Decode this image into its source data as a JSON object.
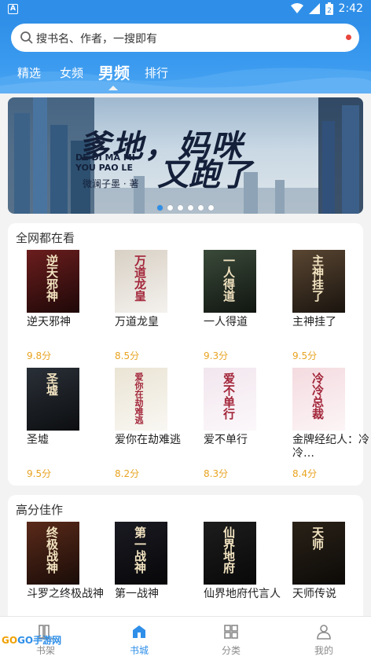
{
  "statusbar": {
    "app_icon": "A",
    "time": "2:42",
    "battery": "2"
  },
  "search": {
    "placeholder": "搜书名、作者，一搜即有"
  },
  "tabs": [
    {
      "label": "精选"
    },
    {
      "label": "女频"
    },
    {
      "label": "男频"
    },
    {
      "label": "排行"
    }
  ],
  "banner": {
    "title_line1": "爹地，妈咪",
    "title_line2": "又跑了",
    "pinyin_line1": "DE DI MA MI",
    "pinyin_line2": "YOU PAO LE",
    "author": "微澜子墨 · 著",
    "dot_count": 6,
    "active_dot": 0
  },
  "section1": {
    "title": "全网都在看",
    "books": [
      {
        "name": "逆天邪神",
        "score": "9.8分",
        "cover_text": "逆天邪神",
        "cover_bg": "#6b1d1d"
      },
      {
        "name": "万道龙皇",
        "score": "8.5分",
        "cover_text": "万道龙皇",
        "cover_bg": "#d8d0c4"
      },
      {
        "name": "一人得道",
        "score": "9.3分",
        "cover_text": "一人得道",
        "cover_bg": "#3a4a3a"
      },
      {
        "name": "主神挂了",
        "score": "9.5分",
        "cover_text": "主神挂了",
        "cover_bg": "#5a4632"
      },
      {
        "name": "圣墟",
        "score": "9.5分",
        "cover_text": "圣墟",
        "cover_bg": "#2a3038"
      },
      {
        "name": "爱你在劫难逃",
        "score": "8.2分",
        "cover_text": "爱你在劫难逃",
        "cover_bg": "#eae4d4"
      },
      {
        "name": "爱不单行",
        "score": "8.3分",
        "cover_text": "爱不单行",
        "cover_bg": "#f2e6ee"
      },
      {
        "name": "金牌经纪人：冷冷…",
        "score": "8.4分",
        "cover_text": "冷冷总裁",
        "cover_bg": "#f4dbe0"
      }
    ]
  },
  "section2": {
    "title": "高分佳作",
    "books": [
      {
        "name": "斗罗之终极战神",
        "cover_text": "终极战神",
        "cover_bg": "#5a2a1a"
      },
      {
        "name": "第一战神",
        "cover_text": "第一战神",
        "cover_bg": "#1a1a22"
      },
      {
        "name": "仙界地府代言人",
        "cover_text": "仙界地府",
        "cover_bg": "#1d1d1d"
      },
      {
        "name": "天师传说",
        "cover_text": "天师",
        "cover_bg": "#2a2218"
      }
    ]
  },
  "bottom_nav": [
    {
      "label": "书架",
      "icon": "bookshelf-icon"
    },
    {
      "label": "书城",
      "icon": "bookstore-icon",
      "active": true
    },
    {
      "label": "分类",
      "icon": "category-icon"
    },
    {
      "label": "我的",
      "icon": "profile-icon"
    }
  ],
  "watermark": {
    "text1": "GO",
    "text2": "GO",
    "text3": "手游网"
  },
  "colors": {
    "accent": "#2f8fe8",
    "score": "#e8a321"
  }
}
